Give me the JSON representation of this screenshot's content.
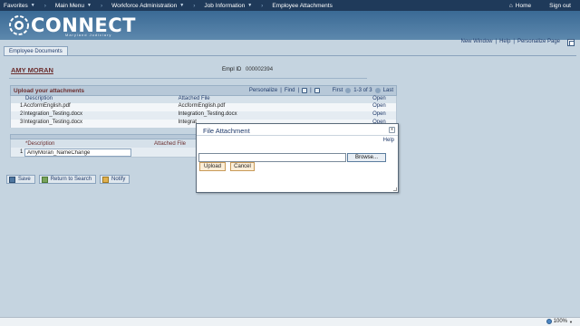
{
  "topnav": {
    "items": [
      {
        "label": "Favorites",
        "caret": true
      },
      {
        "label": "Main Menu",
        "caret": true
      },
      {
        "label": "Workforce Administration",
        "caret": true
      },
      {
        "label": "Job Information",
        "caret": true
      },
      {
        "label": "Employee Attachments",
        "caret": false
      }
    ],
    "home": "Home",
    "signout": "Sign out"
  },
  "banner": {
    "logo_text": "CONNECT",
    "logo_sub": "Maryland Judiciary"
  },
  "sublinks": {
    "new_window": "New Window",
    "help": "Help",
    "personalize": "Personalize Page",
    "sep": "|"
  },
  "tab": {
    "label": "Employee Documents"
  },
  "employee": {
    "name": "AMY MORAN",
    "emplid_label": "Empl ID",
    "emplid": "000002394"
  },
  "attachments": {
    "title": "Upload your attachments",
    "personalize": "Personalize",
    "find": "Find",
    "first": "First",
    "range": "1-3 of 3",
    "last": "Last",
    "sep": "|",
    "columns": {
      "description": "Description",
      "file": "Attached File",
      "open": "Open"
    },
    "rows": [
      {
        "num": "1",
        "description": "AccformEnglish.pdf",
        "file": "AccformEnglish.pdf",
        "open": "Open"
      },
      {
        "num": "2",
        "description": "Integration_Testing.docx",
        "file": "Integration_Testing.docx",
        "open": "Open"
      },
      {
        "num": "3",
        "description": "Integration_Testing.docx",
        "file": "Integrat",
        "open": "Open"
      }
    ]
  },
  "new_attachment": {
    "col_description": "*Description",
    "col_file": "Attached File",
    "num": "1",
    "description_value": "AmyMoran_NameChange"
  },
  "actions": {
    "save": "Save",
    "return": "Return to Search",
    "notify": "Notify"
  },
  "dialog": {
    "title": "File Attachment",
    "close": "x",
    "help": "Help",
    "browse": "Browse...",
    "upload": "Upload",
    "cancel": "Cancel"
  },
  "statusbar": {
    "zoom": "100%"
  }
}
